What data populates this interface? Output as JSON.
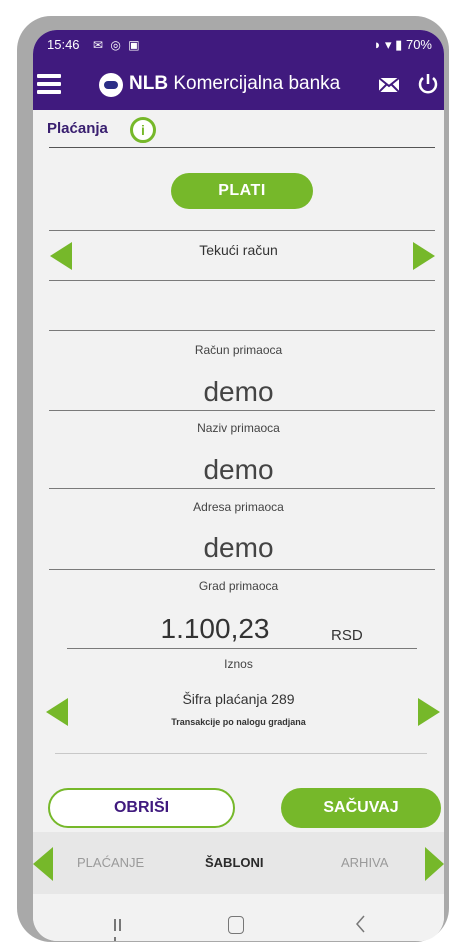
{
  "status_bar": {
    "time": "15:46",
    "battery": "70%"
  },
  "header": {
    "brand_bold": "NLB",
    "brand_rest": " Komercijalna banka"
  },
  "section": {
    "title": "Plaćanja",
    "info_glyph": "i"
  },
  "pay_button": "PLATI",
  "account_selector": {
    "label": "Tekući račun"
  },
  "form": {
    "recipient_account_label": "Račun primaoca",
    "recipient_name_value": "demo",
    "recipient_name_label": "Naziv primaoca",
    "recipient_address_value": "demo",
    "recipient_address_label": "Adresa primaoca",
    "recipient_city_value": "demo",
    "recipient_city_label": "Grad primaoca",
    "amount_value": "1.100,23",
    "currency": "RSD",
    "amount_label": "Iznos"
  },
  "payment_code": {
    "title": "Šifra plaćanja 289",
    "description": "Transakcije po nalogu gradjana"
  },
  "actions": {
    "delete": "OBRIŠI",
    "save": "SAČUVAJ"
  },
  "tabs": [
    "PLAĆANJE",
    "ŠABLONI",
    "ARHIVA"
  ],
  "icons": {
    "menu": "hamburger-icon",
    "logo": "nlb-logo-icon",
    "mail": "mail-icon",
    "power": "power-icon",
    "info": "info-icon",
    "prev": "arrow-left-icon",
    "next": "arrow-right-icon"
  },
  "colors": {
    "header": "#401a7e",
    "accent": "#76b82a"
  }
}
